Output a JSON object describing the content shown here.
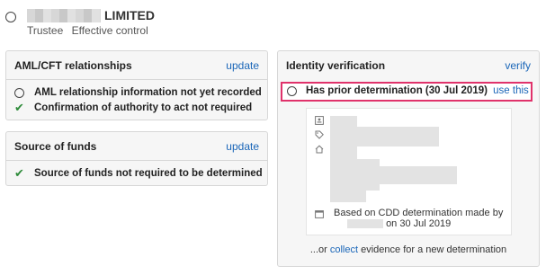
{
  "entity": {
    "name": "LIMITED",
    "roles": [
      "Trustee",
      "Effective control"
    ]
  },
  "aml_panel": {
    "title": "AML/CFT relationships",
    "action": "update",
    "items": [
      {
        "status": "pending",
        "label": "AML relationship information not yet recorded"
      },
      {
        "status": "done",
        "label": "Confirmation of authority to act not required"
      }
    ]
  },
  "funds_panel": {
    "title": "Source of funds",
    "action": "update",
    "items": [
      {
        "status": "done",
        "label": "Source of funds not required to be determined"
      }
    ]
  },
  "identity_panel": {
    "title": "Identity verification",
    "action": "verify",
    "determination_label": "Has prior determination (30 Jul 2019)",
    "determination_action": "use this",
    "card_note_line1": "Based on CDD determination made by",
    "card_note_line2": "on 30 Jul 2019",
    "footer_prefix": "...or ",
    "footer_link": "collect",
    "footer_suffix": " evidence for a new determination"
  },
  "icons": {
    "pending": "radio-circle",
    "done": "check-icon",
    "id_card": "id-card-icon",
    "tag": "tag-icon",
    "home": "home-icon",
    "calendar": "calendar-icon"
  },
  "colors": {
    "link": "#1a66b8",
    "check": "#2e8b3a",
    "highlight_border": "#e0326b"
  }
}
